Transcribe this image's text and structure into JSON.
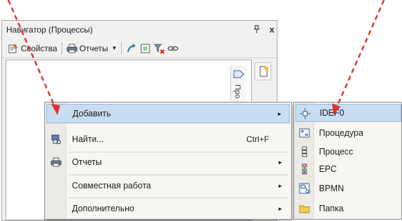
{
  "navigator": {
    "title": "Навигатор (Процессы)",
    "pin_glyph": "ᵖ",
    "close_glyph": "x",
    "toolbar": {
      "properties_label": "Свойства",
      "reports_label": "Отчеты",
      "icons": [
        "properties-icon",
        "reports-icon",
        "navigate-icon",
        "refresh-icon",
        "clear-filter-icon",
        "link-icon"
      ]
    },
    "side_tab_label": "Про"
  },
  "context_menu": {
    "items": [
      {
        "label": "Добавить",
        "shortcut": "",
        "has_submenu": true,
        "highlighted": true,
        "icon": ""
      },
      {
        "label": "Найти...",
        "shortcut": "Ctrl+F",
        "has_submenu": false,
        "highlighted": false,
        "icon": "find-icon"
      },
      {
        "label": "Отчеты",
        "shortcut": "",
        "has_submenu": true,
        "highlighted": false,
        "icon": "printer-icon"
      },
      {
        "label": "Совместная работа",
        "shortcut": "",
        "has_submenu": true,
        "highlighted": false,
        "icon": ""
      },
      {
        "label": "Дополнительно",
        "shortcut": "",
        "has_submenu": true,
        "highlighted": false,
        "icon": ""
      }
    ],
    "arrow_glyph": "►"
  },
  "submenu": {
    "items": [
      {
        "label": "IDEF0",
        "icon": "idef0-icon",
        "highlighted": true
      },
      {
        "label": "Процедура",
        "icon": "procedure-icon",
        "highlighted": false
      },
      {
        "label": "Процесс",
        "icon": "process-icon",
        "highlighted": false
      },
      {
        "label": "EPC",
        "icon": "epc-icon",
        "highlighted": false
      },
      {
        "label": "BPMN",
        "icon": "bpmn-icon",
        "highlighted": false
      },
      {
        "label": "Папка",
        "icon": "folder-icon",
        "highlighted": false
      }
    ]
  },
  "colors": {
    "highlight": "#c9ddf2",
    "annotation_arrow": "#e0302b"
  }
}
